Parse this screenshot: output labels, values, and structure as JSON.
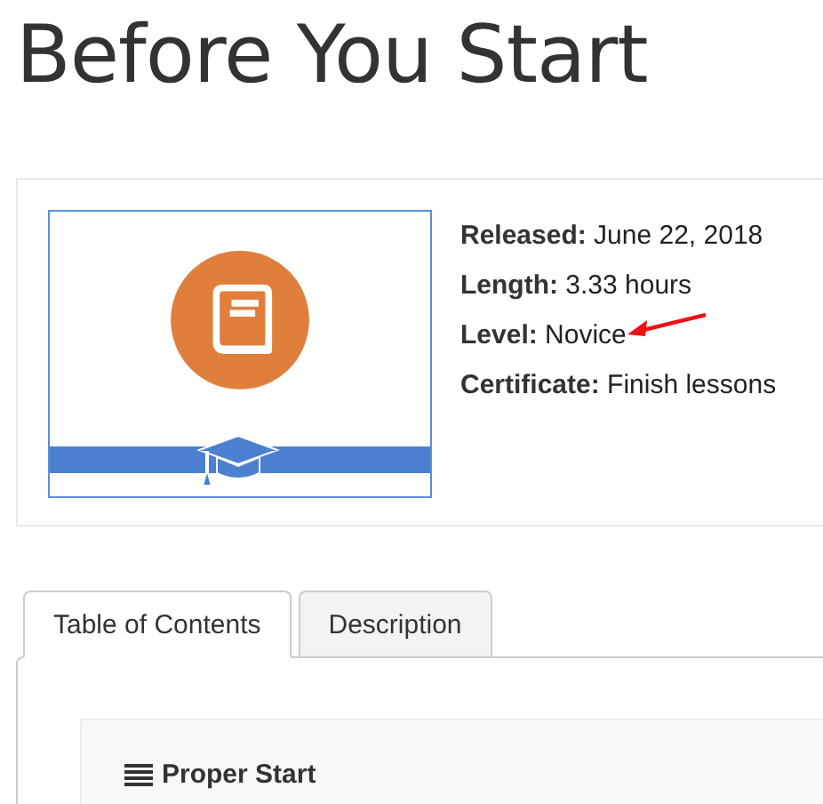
{
  "title": "Before You Start",
  "course": {
    "details": [
      {
        "label": "Released:",
        "value": "June 22, 2018",
        "annotated": false
      },
      {
        "label": "Length:",
        "value": "3.33 hours",
        "annotated": false
      },
      {
        "label": "Level:",
        "value": "Novice",
        "annotated": true
      },
      {
        "label": "Certificate:",
        "value": "Finish lessons",
        "annotated": false
      }
    ]
  },
  "tabs": [
    {
      "label": "Table of Contents",
      "selected": true
    },
    {
      "label": "Description",
      "selected": false
    }
  ],
  "sections": [
    {
      "title": "Proper Start"
    }
  ]
}
